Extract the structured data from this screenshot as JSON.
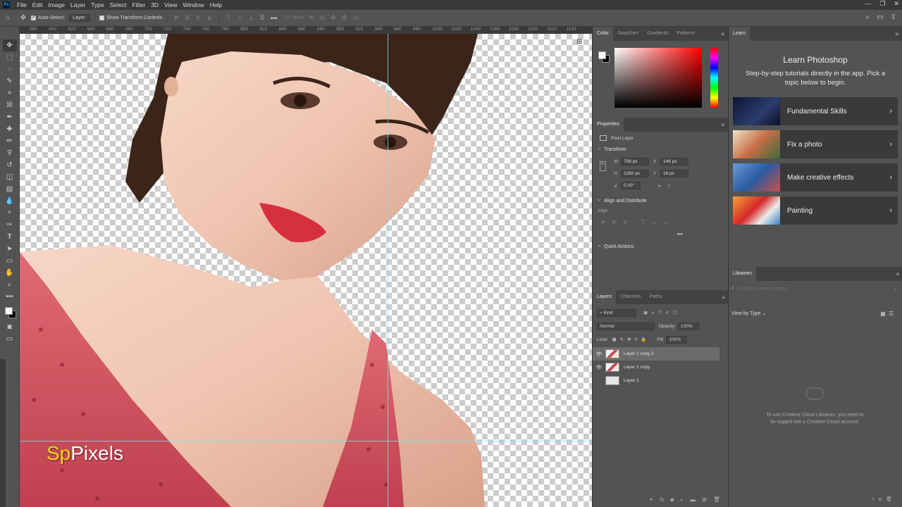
{
  "menubar": {
    "logo": "Ps",
    "items": [
      "File",
      "Edit",
      "Image",
      "Layer",
      "Type",
      "Select",
      "Filter",
      "3D",
      "View",
      "Window",
      "Help"
    ],
    "window_controls": [
      "—",
      "❐",
      "✕"
    ]
  },
  "options_bar": {
    "auto_select_label": "Auto-Select:",
    "auto_select_checked": true,
    "auto_select_target": "Layer",
    "show_transform_label": "Show Transform Controls",
    "mode_3d_label": "3D Mode:"
  },
  "ruler": {
    "ticks": [
      "580",
      "600",
      "620",
      "640",
      "660",
      "680",
      "700",
      "720",
      "740",
      "760",
      "780",
      "800",
      "820",
      "840",
      "860",
      "880",
      "900",
      "920",
      "940",
      "960",
      "980",
      "1000",
      "1020",
      "1040",
      "1060",
      "1080",
      "1100",
      "1120",
      "1140"
    ]
  },
  "canvas": {
    "watermark_sp": "Sp",
    "watermark_pixels": "Pixels"
  },
  "color_panel": {
    "tabs": [
      "Color",
      "Swatches",
      "Gradients",
      "Patterns"
    ],
    "active_tab": "Color",
    "fg_color": "#ffffff",
    "bg_color": "#000000"
  },
  "properties": {
    "title": "Properties",
    "layer_type": "Pixel Layer",
    "transform_title": "Transform",
    "w": "708 px",
    "x": "146 px",
    "h": "1282 px",
    "y": "16 px",
    "angle": "0.00°",
    "align_title": "Align and Distribute",
    "align_label": "Align:",
    "quick_actions_title": "Quick Actions"
  },
  "layers_panel": {
    "tabs": [
      "Layers",
      "Channels",
      "Paths"
    ],
    "active_tab": "Layers",
    "kind_label": "Kind",
    "blend_mode": "Normal",
    "opacity_label": "Opacity:",
    "opacity": "100%",
    "lock_label": "Lock:",
    "fill_label": "Fill:",
    "fill": "100%",
    "layers": [
      {
        "name": "Layer 1 copy 2",
        "visible": true,
        "selected": true
      },
      {
        "name": "Layer 1 copy",
        "visible": true,
        "selected": false
      },
      {
        "name": "Layer 1",
        "visible": false,
        "selected": false
      }
    ]
  },
  "learn_panel": {
    "tab": "Learn",
    "title": "Learn Photoshop",
    "subtitle": "Step-by-step tutorials directly in the app. Pick a topic below to begin.",
    "cards": [
      {
        "label": "Fundamental Skills",
        "color": "#1d2a4a"
      },
      {
        "label": "Fix a photo",
        "color": "#c9a56a"
      },
      {
        "label": "Make creative effects",
        "color": "#2f5fa8"
      },
      {
        "label": "Painting",
        "color": "#d32f2f"
      }
    ]
  },
  "libraries_panel": {
    "tab": "Libraries",
    "search_placeholder": "Search Current Library",
    "view_by": "View by Type",
    "message": "To use Creative Cloud Libraries, you need to be logged into a Creative Cloud account."
  }
}
